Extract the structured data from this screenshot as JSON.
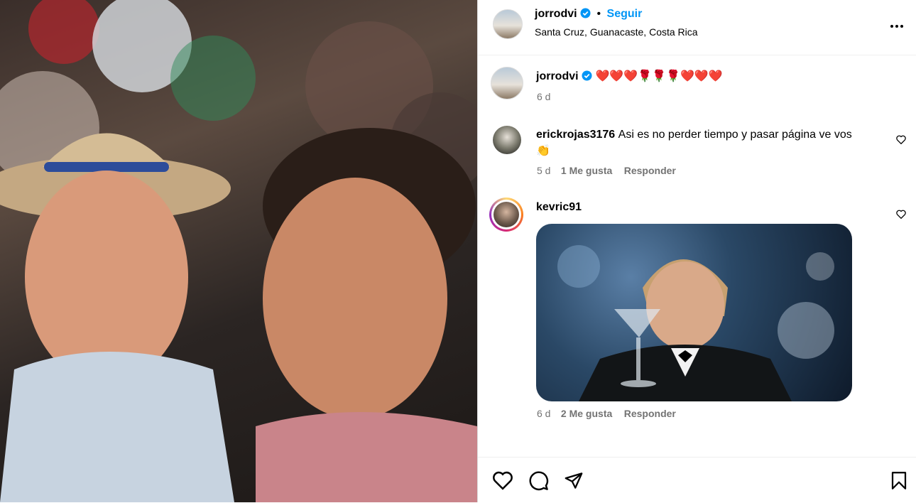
{
  "post": {
    "username": "jorrodvi",
    "follow_label": "Seguir",
    "separator": "•",
    "location": "Santa Cruz, Guanacaste, Costa Rica",
    "caption_emojis": "❤️❤️❤️🌹🌹🌹❤️❤️❤️",
    "caption_time": "6 d"
  },
  "comments": [
    {
      "username": "erickrojas3176",
      "text_line1": "Asi es no perder tiempo y pasar página ve vos",
      "text_line2": "👏",
      "time": "5 d",
      "likes": "1 Me gusta",
      "reply": "Responder"
    },
    {
      "username": "kevric91",
      "time": "6 d",
      "likes": "2 Me gusta",
      "reply": "Responder"
    }
  ],
  "icons": {
    "more": "more-options-icon",
    "like": "heart-icon",
    "comment": "comment-icon",
    "share": "send-icon",
    "save": "bookmark-icon"
  },
  "colors": {
    "accent": "#0095f6",
    "muted": "#737373",
    "verified": "#0095f6"
  }
}
